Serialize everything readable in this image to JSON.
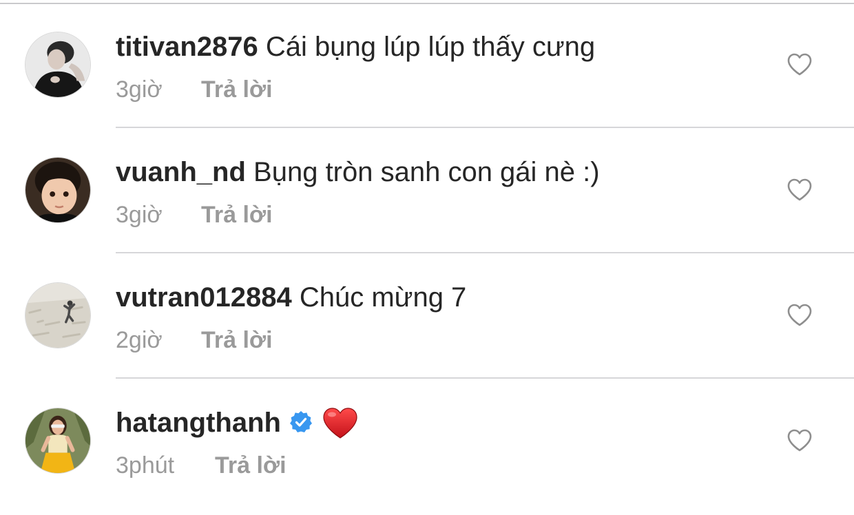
{
  "comments": [
    {
      "username": "titivan2876",
      "text": "Cái bụng lúp lúp thấy cưng",
      "time": "3giờ",
      "reply_label": "Trả lời",
      "avatar_icon": "user-avatar-woman-dark",
      "verified": false
    },
    {
      "username": "vuanh_nd",
      "text": "Bụng tròn sanh con gái nè :)",
      "time": "3giờ",
      "reply_label": "Trả lời",
      "avatar_icon": "user-avatar-child",
      "verified": false
    },
    {
      "username": "vutran012884",
      "text": "Chúc mừng 7",
      "time": "2giờ",
      "reply_label": "Trả lời",
      "avatar_icon": "user-avatar-landscape",
      "verified": false
    },
    {
      "username": "hatangthanh",
      "text": "❤️",
      "time": "3phút",
      "reply_label": "Trả lời",
      "avatar_icon": "user-avatar-woman-yellow",
      "verified": true
    }
  ],
  "colors": {
    "text": "#262626",
    "meta": "#9a9a9a",
    "divider": "#d6d6d9",
    "verified_badge": "#3897f0",
    "red_heart": "#e0191f"
  }
}
